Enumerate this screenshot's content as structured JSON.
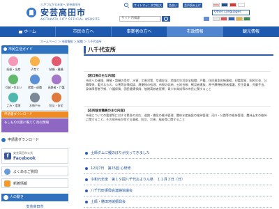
{
  "header": {
    "tagline": "人がつながる未来へ 安芸高田市",
    "site_name": "安芸高田市",
    "site_roman": "AKITAKATA CITY OFFICIAL WEBSITE",
    "util_buttons": [
      "サイトマップ",
      "文字拡大",
      "色合い",
      "音声読み上げ"
    ],
    "search_placeholder": "サイト内検索",
    "other_languages": "Other Languages"
  },
  "nav": {
    "items": [
      {
        "label": "ホーム"
      },
      {
        "label": "市民の方へ"
      },
      {
        "label": "事業者の方へ"
      },
      {
        "label": "市政情報"
      },
      {
        "label": "観光情報"
      }
    ]
  },
  "breadcrumb": "ホームページ ＞ 市政情報 ＞ 組織 ＞ 八千代支所",
  "sidebar": {
    "guide_title": "市民生活ガイド",
    "guide_items": [
      {
        "label": "妊娠・出産",
        "color": "#f49ab8"
      },
      {
        "label": "子育て",
        "color": "#f7b24c"
      },
      {
        "label": "結婚・離婚",
        "color": "#e25a6e"
      },
      {
        "label": "引越・住まい",
        "color": "#63b86e"
      },
      {
        "label": "就職・退職",
        "color": "#5a8fd6"
      },
      {
        "label": "高齢者・介護",
        "color": "#a477c9"
      },
      {
        "label": "ごみ・環境",
        "color": "#4fb6b0"
      },
      {
        "label": "お悔やみ",
        "color": "#7b8896"
      },
      {
        "label": "防災・安全",
        "color": "#e07a3c"
      }
    ],
    "orange_banner": "申請書ダウンロード",
    "purple_banner": "もしもの災害に備えて 防災情報",
    "download_label": "申請書ダウンロード",
    "facebook_caption": "安芸高田市公式",
    "facebook_name": "Facebook",
    "faq_label": "よくあるご質問",
    "rss_label": "新着情報",
    "population_label": "人の動き",
    "city_name": "安芸高田市"
  },
  "main": {
    "title": "八千代支所",
    "blocks": [
      {
        "heading": "【窓口係の主な内容】",
        "text": "市民への連絡、陳情・請願の受付、水害、災害対策、交通安全、地域の生活安全組織、戸籍、住民基本台帳事務、印鑑登録、国民年金、公費関係、重大なもの、公害等苦情相談、廃棄物の処理、市税の収納、土地台帳、戦没者遺族、原子爆弾被害者援護、民生委員、児童手当、身体障害者手帳、介護保険、国民健康保険、後期高齢者医療、青少年育成等の市民に関すること"
      },
      {
        "heading": "【支所総合職員の主な内容】",
        "text": "市政についての要望等に対する緊急の対応、道路・橋梁の維持管理、農林水産施設の維持管理、河川・公園等の維持管理、農林土木の維持に関すること、その他市長が命ずる業務、防災、災害、福祉等に関すること"
      }
    ],
    "news": [
      "土師ダムに鯉のぼりが戻ってきました",
      "12月7日　第25回 心研修",
      "令和元年度　第１９回八千代およりん祭　１１月３日（日）",
      "八千代町振興会連絡協議会",
      "土師・勝田地域振興会",
      "佐々井地域振興会"
    ]
  }
}
